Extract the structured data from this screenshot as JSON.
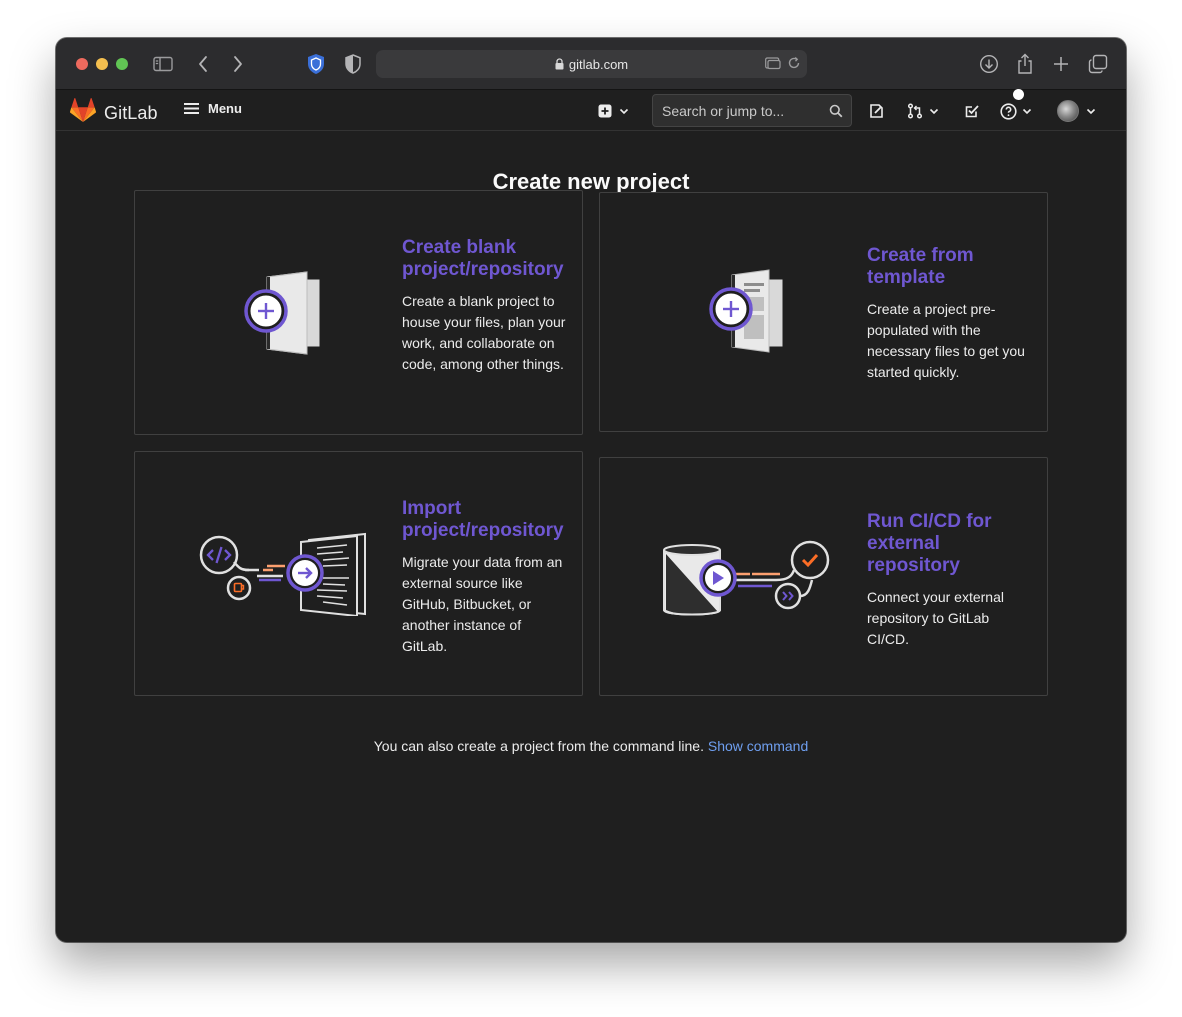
{
  "browser": {
    "url": "gitlab.com"
  },
  "navbar": {
    "brand": "GitLab",
    "menu_label": "Menu",
    "search_placeholder": "Search or jump to..."
  },
  "page": {
    "title": "Create new project",
    "cards": [
      {
        "title": "Create blank project/repository",
        "description": "Create a blank project to house your files, plan your work, and collaborate on code, among other things.",
        "icon": "blank-project-icon"
      },
      {
        "title": "Create from template",
        "description": "Create a project pre-populated with the necessary files to get you started quickly.",
        "icon": "template-project-icon"
      },
      {
        "title": "Import project/repository",
        "description": "Migrate your data from an external source like GitHub, Bitbucket, or another instance of GitLab.",
        "icon": "import-project-icon"
      },
      {
        "title": "Run CI/CD for external repository",
        "description": "Connect your external repository to GitLab CI/CD.",
        "icon": "cicd-project-icon"
      }
    ],
    "footer_text": "You can also create a project from the command line.",
    "footer_link": "Show command"
  },
  "colors": {
    "accent_purple": "#6f57d1",
    "link_blue": "#6f9ff0",
    "background": "#1f1f1f",
    "card_border": "#404040",
    "gitlab_orange": "#fc6d26"
  }
}
